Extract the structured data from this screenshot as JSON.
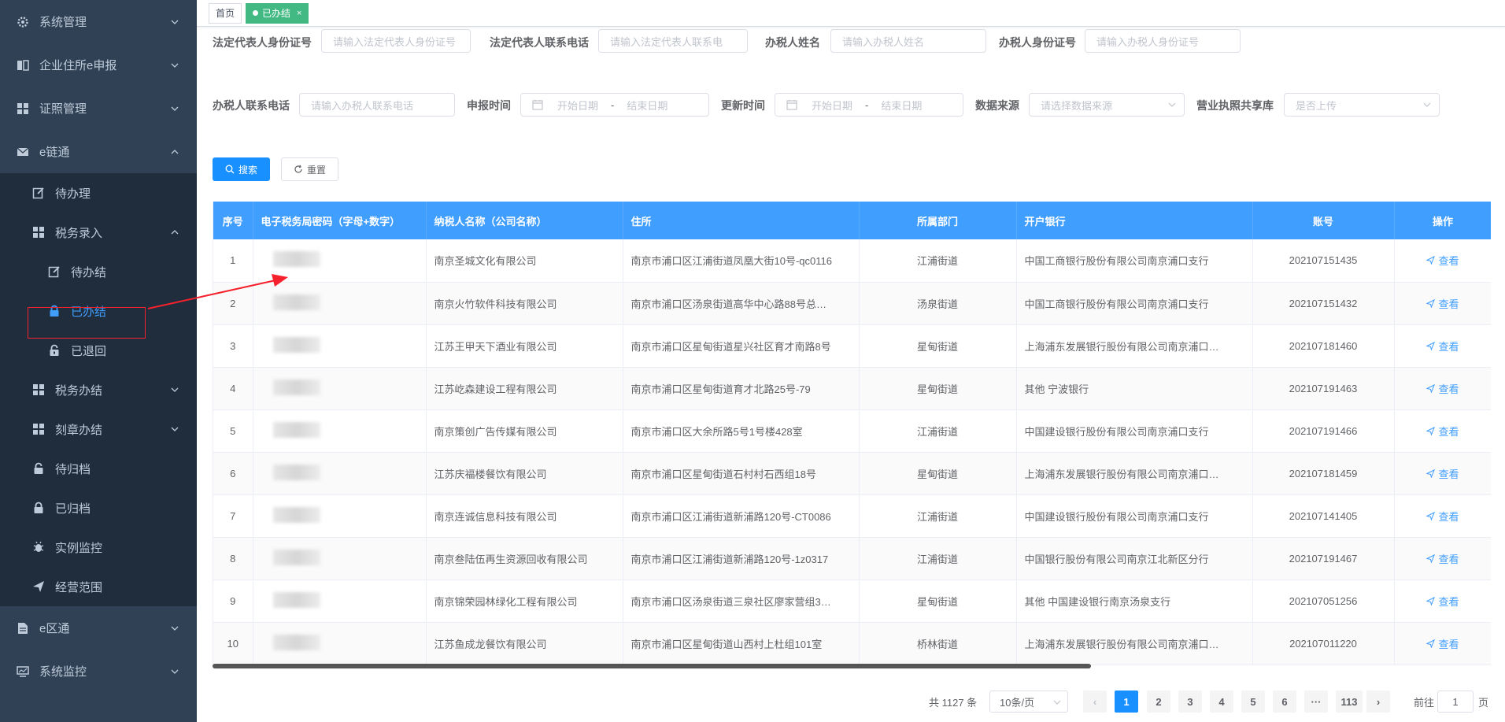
{
  "sidebar": {
    "items": [
      {
        "label": "系统管理",
        "icon": "gear-icon"
      },
      {
        "label": "企业住所e申报",
        "icon": "book-icon"
      },
      {
        "label": "证照管理",
        "icon": "grid-icon"
      },
      {
        "label": "e链通",
        "icon": "mail-icon"
      }
    ],
    "elink_children": {
      "pending": "待办理",
      "tax_entry": "税务录入",
      "tax_children": {
        "pending_close": "待办结",
        "closed": "已办结",
        "returned": "已退回"
      },
      "tax_done": "税务办结",
      "seal_done": "刻章办结",
      "pending_archive": "待归档",
      "archived": "已归档",
      "instance_monitor": "实例监控",
      "business_scope": "经营范围"
    },
    "bottom_items": [
      {
        "label": "e区通",
        "icon": "document-icon"
      },
      {
        "label": "系统监控",
        "icon": "monitor-icon"
      }
    ]
  },
  "tags": {
    "home": "首页",
    "current": "已办结"
  },
  "form": {
    "legal_id_label": "法定代表人身份证号",
    "legal_id_placeholder": "请输入法定代表人身份证号",
    "legal_phone_label": "法定代表人联系电话",
    "legal_phone_placeholder": "请输入法定代表人联系电",
    "agent_name_label": "办税人姓名",
    "agent_name_placeholder": "请输入办税人姓名",
    "agent_id_label": "办税人身份证号",
    "agent_id_placeholder": "请输入办税人身份证号",
    "agent_phone_label": "办税人联系电话",
    "agent_phone_placeholder": "请输入办税人联系电话",
    "apply_time_label": "申报时间",
    "update_time_label": "更新时间",
    "start_date": "开始日期",
    "end_date": "结束日期",
    "date_sep": "-",
    "source_label": "数据来源",
    "source_placeholder": "请选择数据来源",
    "share_label": "营业执照共享库",
    "share_placeholder": "是否上传",
    "search_btn": "搜索",
    "reset_btn": "重置"
  },
  "table": {
    "headers": [
      "序号",
      "电子税务局密码（字母+数字）",
      "纳税人名称（公司名称）",
      "住所",
      "所属部门",
      "开户银行",
      "账号",
      "操作"
    ],
    "view_label": "查看",
    "rows": [
      {
        "no": "1",
        "name": "南京圣城文化有限公司",
        "address": "南京市浦口区江浦街道凤凰大街10号-qc0116",
        "dept": "江浦街道",
        "bank": "中国工商银行股份有限公司南京浦口支行",
        "account": "202107151435"
      },
      {
        "no": "2",
        "name": "南京火竹软件科技有限公司",
        "address": "南京市浦口区汤泉街道高华中心路88号总…",
        "dept": "汤泉街道",
        "bank": "中国工商银行股份有限公司南京浦口支行",
        "account": "202107151432"
      },
      {
        "no": "3",
        "name": "江苏王甲天下酒业有限公司",
        "address": "南京市浦口区星甸街道星兴社区育才南路8号",
        "dept": "星甸街道",
        "bank": "上海浦东发展银行股份有限公司南京浦口…",
        "account": "202107181460"
      },
      {
        "no": "4",
        "name": "江苏屹森建设工程有限公司",
        "address": "南京市浦口区星甸街道育才北路25号-79",
        "dept": "星甸街道",
        "bank": "其他  宁波银行",
        "account": "202107191463"
      },
      {
        "no": "5",
        "name": "南京策创广告传媒有限公司",
        "address": "南京市浦口区大余所路5号1号楼428室",
        "dept": "江浦街道",
        "bank": "中国建设银行股份有限公司南京浦口支行",
        "account": "202107191466"
      },
      {
        "no": "6",
        "name": "江苏庆福楼餐饮有限公司",
        "address": "南京市浦口区星甸街道石村村石西组18号",
        "dept": "星甸街道",
        "bank": "上海浦东发展银行股份有限公司南京浦口…",
        "account": "202107181459"
      },
      {
        "no": "7",
        "name": "南京连诚信息科技有限公司",
        "address": "南京市浦口区江浦街道新浦路120号-CT0086",
        "dept": "江浦街道",
        "bank": "中国建设银行股份有限公司南京浦口支行",
        "account": "202107141405"
      },
      {
        "no": "8",
        "name": "南京叁陆伍再生资源回收有限公司",
        "address": "南京市浦口区江浦街道新浦路120号-1z0317",
        "dept": "江浦街道",
        "bank": "中国银行股份有限公司南京江北新区分行",
        "account": "202107191467"
      },
      {
        "no": "9",
        "name": "南京锦荣园林绿化工程有限公司",
        "address": "南京市浦口区汤泉街道三泉社区廖家营组3…",
        "dept": "星甸街道",
        "bank": "其他  中国建设银行南京汤泉支行",
        "account": "202107051256"
      },
      {
        "no": "10",
        "name": "江苏鱼成龙餐饮有限公司",
        "address": "南京市浦口区星甸街道山西村上杜组101室",
        "dept": "桥林街道",
        "bank": "上海浦东发展银行股份有限公司南京浦口…",
        "account": "202107011220"
      }
    ]
  },
  "pagination": {
    "total": "共 1127 条",
    "page_size": "10条/页",
    "pages": [
      "1",
      "2",
      "3",
      "4",
      "5",
      "6",
      "···",
      "113"
    ],
    "current_page": "1",
    "goto_label": "前往",
    "goto_value": "1",
    "page_unit": "页"
  },
  "colors": {
    "sidebar_bg": "#304156",
    "primary": "#409eff",
    "tag_active": "#42b983",
    "annotation": "#f5222d"
  }
}
